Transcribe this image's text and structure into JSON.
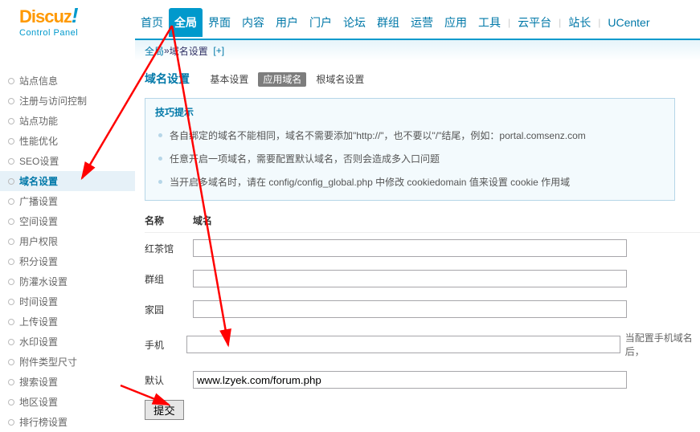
{
  "logo": {
    "brand": "Discuz",
    "bang": "!",
    "sub": "Control Panel"
  },
  "topnav": {
    "items": [
      "首页",
      "全局",
      "界面",
      "内容",
      "用户",
      "门户",
      "论坛",
      "群组",
      "运营",
      "应用",
      "工具",
      "云平台",
      "站长",
      "UCenter"
    ],
    "active_index": 1
  },
  "breadcrumb": {
    "root": "全局",
    "sep": " » ",
    "page": "域名设置",
    "more": "[+]"
  },
  "sidebar": {
    "items": [
      "站点信息",
      "注册与访问控制",
      "站点功能",
      "性能优化",
      "SEO设置",
      "域名设置",
      "广播设置",
      "空间设置",
      "用户权限",
      "积分设置",
      "防灌水设置",
      "时间设置",
      "上传设置",
      "水印设置",
      "附件类型尺寸",
      "搜索设置",
      "地区设置",
      "排行榜设置"
    ],
    "active_index": 5
  },
  "section": {
    "main_title": "域名设置",
    "subtabs": [
      "基本设置",
      "应用域名",
      "根域名设置"
    ],
    "subtab_active_index": 1
  },
  "tips": {
    "title": "技巧提示",
    "items": [
      "各自绑定的域名不能相同，域名不需要添加\"http://\"，也不要以\"/\"结尾，例如：portal.comsenz.com",
      "任意开启一项域名，需要配置默认域名，否则会造成多入口问题",
      "当开启多域名时，请在 config/config_global.php 中修改 cookiedomain 值来设置 cookie 作用域"
    ]
  },
  "form": {
    "headers": {
      "name": "名称",
      "domain": "域名"
    },
    "rows": [
      {
        "label": "红茶馆",
        "value": ""
      },
      {
        "label": "群组",
        "value": ""
      },
      {
        "label": "家园",
        "value": ""
      },
      {
        "label": "手机",
        "value": "",
        "hint": "当配置手机域名后，"
      },
      {
        "label": "默认",
        "value": "www.lzyek.com/forum.php"
      }
    ],
    "submit": "提交"
  }
}
